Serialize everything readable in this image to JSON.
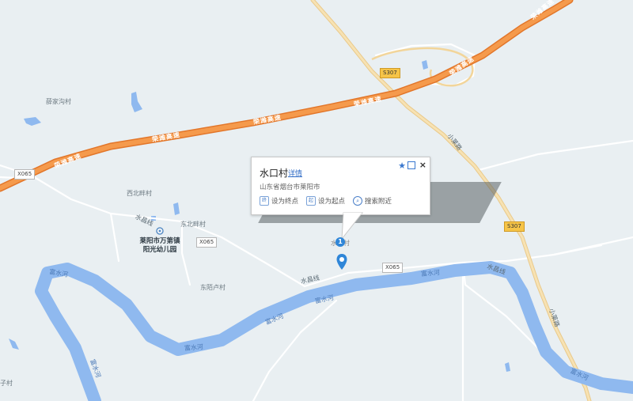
{
  "map": {
    "colors": {
      "land": "#e9eff2",
      "water": "#8fb9ef",
      "expressway": "#f18d3a",
      "expressway_edge": "#e2762a",
      "national_road": "#f2d59a",
      "local_road": "#ffffff",
      "marker": "#2f86d8"
    },
    "highway_labels": [
      "荣潍高速",
      "荣潍高速",
      "荣潍高速",
      "荣潍高速",
      "荣潍高速",
      "荣潍高速",
      "荣潍高速"
    ],
    "road_labels": {
      "x065": "X065",
      "x065_b": "X065",
      "x065_c": "X065",
      "s307_a": "S307",
      "s307_b": "S307",
      "shuichang_1": "水昌线",
      "shuichang_2": "水昌线",
      "shuichang_3": "水昌线",
      "xiaolai_1": "小莱路",
      "xiaolai_2": "小莱路"
    },
    "river_labels": [
      "富水河",
      "富水河",
      "富水河",
      "富水河",
      "富水河",
      "富水河",
      "富水河"
    ],
    "place_labels": {
      "xuejiagou": "薛家沟村",
      "xibeiban": "西北畔村",
      "dongbeiban": "东北畔村",
      "dongmiao": "东陌卢村",
      "zi": "子村",
      "shuikou_label": "水口村"
    },
    "poi": {
      "name_line1": "莱阳市万第镇",
      "name_line2": "阳光幼儿园",
      "icon": "location-pin-icon"
    }
  },
  "popup": {
    "title": "水口村",
    "detail_link": "详情",
    "address": "山东省烟台市莱阳市",
    "actions": [
      {
        "label": "设为终点",
        "icon": "终"
      },
      {
        "label": "设为起点",
        "icon": "起"
      },
      {
        "label": "搜索附近",
        "icon": "search-icon"
      }
    ],
    "close": "×",
    "favorite_icon": "star-icon",
    "share_icon": "share-icon"
  },
  "marker": {
    "number": "1"
  }
}
